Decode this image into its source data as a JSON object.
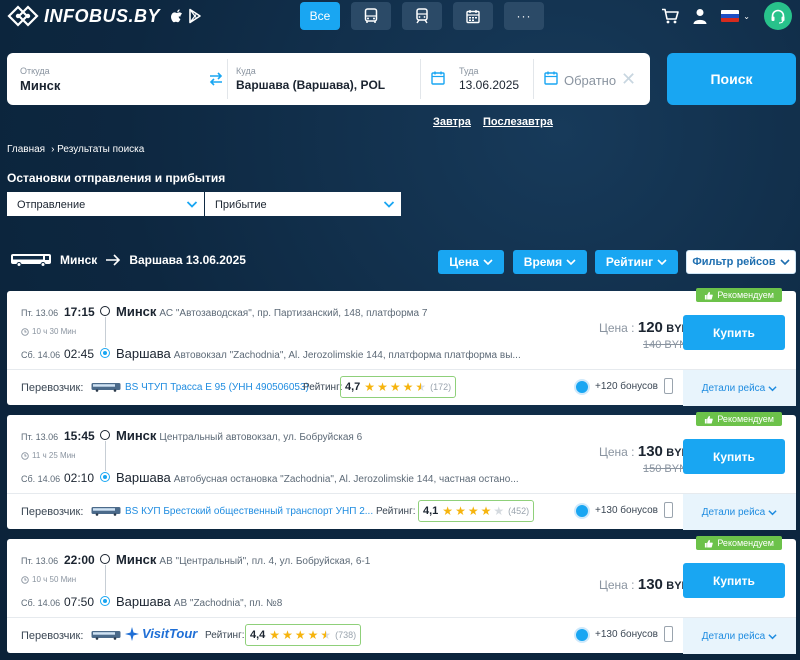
{
  "header": {
    "logo_text": "INFOBUS.BY",
    "tabs": [
      {
        "label": "Все",
        "icon": "all"
      },
      {
        "label": "",
        "icon": "bus-icon"
      },
      {
        "label": "",
        "icon": "train-icon"
      },
      {
        "label": "",
        "icon": "calendar-icon"
      },
      {
        "label": "···",
        "icon": "more-icon"
      }
    ]
  },
  "search": {
    "from_label": "Откуда",
    "from_value": "Минск",
    "to_label": "Куда",
    "to_value": "Варшава (Варшава), POL",
    "depart_label": "Туда",
    "depart_value": "13.06.2025",
    "return_placeholder": "Обратно",
    "search_button": "Поиск",
    "quick_tomorrow": "Завтра",
    "quick_day_after": "Послезавтра"
  },
  "breadcrumbs": [
    "Главная",
    "› Результаты поиска"
  ],
  "stops": {
    "title": "Остановки отправления и прибытия",
    "departure_placeholder": "Отправление",
    "arrival_placeholder": "Прибытие"
  },
  "route": {
    "from": "Минск",
    "to": "Варшава 13.06.2025"
  },
  "sort": {
    "price": "Цена",
    "time": "Время",
    "rating": "Рейтинг",
    "filter": "Фильтр рейсов"
  },
  "trips": [
    {
      "recommended": "Рекомендуем",
      "dep_date": "Пт. 13.06",
      "dep_time": "17:15",
      "duration": "10 ч 30 Мин",
      "dep_city": "Минск",
      "dep_addr": "АС \"Автозаводская\", пр. Партизанский, 148, платформа 7",
      "arr_date": "Сб. 14.06",
      "arr_time": "02:45",
      "arr_city": "Варшава",
      "arr_addr": "Автовокзал \"Zachodnia\", Al. Jerozolimskie 144, платформа платформа вы...",
      "price_label": "Цена :",
      "price": "120",
      "currency": "BYN",
      "old_price": "140 BYN",
      "buy": "Купить",
      "carrier_label": "Перевозчик:",
      "carrier": "BS ЧТУП Трасса Е 95 (УНН 490506053)",
      "rating_label": "Рейтинг:",
      "rating": "4,7",
      "rating_value": 4.7,
      "reviews": "(172)",
      "bonus": "+120 бонусов",
      "details": "Детали рейса"
    },
    {
      "recommended": "Рекомендуем",
      "dep_date": "Пт. 13.06",
      "dep_time": "15:45",
      "duration": "11 ч 25 Мин",
      "dep_city": "Минск",
      "dep_addr": "Центральный автовокзал, ул. Бобруйская 6",
      "arr_date": "Сб. 14.06",
      "arr_time": "02:10",
      "arr_city": "Варшава",
      "arr_addr": "Автобусная остановка \"Zachodnia\", Al. Jerozolimskie 144, частная остано...",
      "price_label": "Цена :",
      "price": "130",
      "currency": "BYN",
      "old_price": "150 BYN",
      "buy": "Купить",
      "carrier_label": "Перевозчик:",
      "carrier": "BS КУП Брестский общественный транспорт УНП 2...",
      "rating_label": "Рейтинг:",
      "rating": "4,1",
      "rating_value": 4.1,
      "reviews": "(452)",
      "bonus": "+130 бонусов",
      "details": "Детали рейса"
    },
    {
      "recommended": "Рекомендуем",
      "dep_date": "Пт. 13.06",
      "dep_time": "22:00",
      "duration": "10 ч 50 Мин",
      "dep_city": "Минск",
      "dep_addr": "АВ \"Центральный\", пл. 4, ул. Бобруйская, 6-1",
      "arr_date": "Сб. 14.06",
      "arr_time": "07:50",
      "arr_city": "Варшава",
      "arr_addr": "АВ \"Zachodnia\", пл. №8",
      "price_label": "Цена :",
      "price": "130",
      "currency": "BYN",
      "old_price": "",
      "buy": "Купить",
      "carrier_label": "Перевозчик:",
      "carrier": "VisitTour",
      "rating_label": "Рейтинг:",
      "rating": "4,4",
      "rating_value": 4.4,
      "reviews": "(738)",
      "bonus": "+130 бонусов",
      "details": "Детали рейса"
    }
  ],
  "colors": {
    "accent": "#19a6f2",
    "background": "#0e2a44",
    "recommended": "#6cc24a",
    "star": "#f6b40e"
  }
}
